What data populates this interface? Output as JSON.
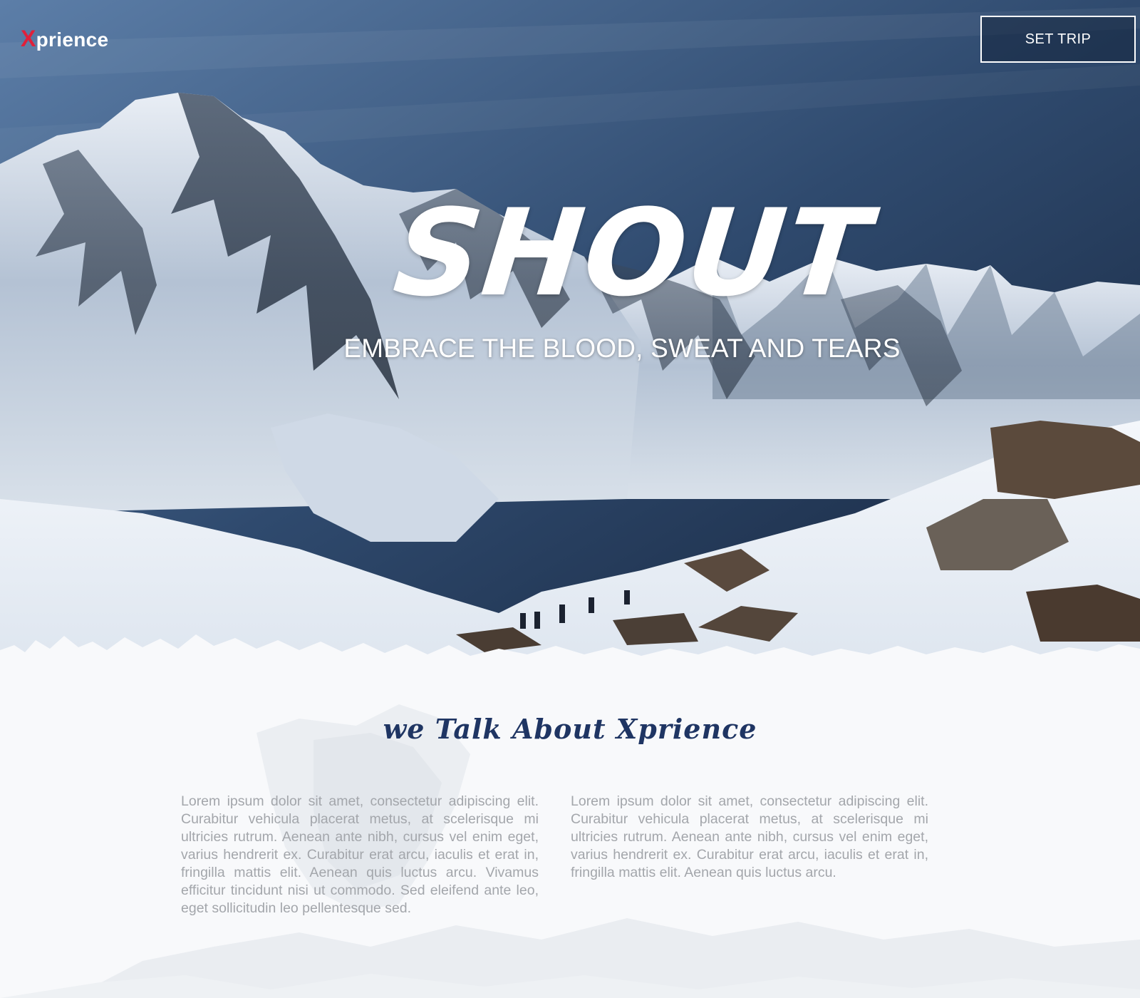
{
  "header": {
    "logo_initial": "X",
    "logo_rest": "prience",
    "set_trip_label": "SET TRIP"
  },
  "hero": {
    "title": "SHOUT",
    "tagline": "EMBRACE THE BLOOD, SWEAT AND TEARS"
  },
  "about": {
    "title": "we Talk About Xprience",
    "paragraph_left": "Lorem ipsum dolor sit amet, consectetur adipiscing elit. Curabitur vehicula placerat metus, at scelerisque mi ultricies rutrum. Aenean ante nibh, cursus vel enim eget, varius hendrerit ex. Curabitur erat arcu, iaculis et erat in, fringilla mattis elit. Aenean quis luctus arcu. Vivamus efficitur tincidunt nisi ut commodo. Sed eleifend ante leo, eget sollicitudin leo pellentesque sed.",
    "paragraph_right": "Lorem ipsum dolor sit amet, consectetur adipiscing elit. Curabitur vehicula placerat metus, at scelerisque mi ultricies rutrum. Aenean ante nibh, cursus vel enim eget, varius hendrerit ex. Curabitur erat arcu, iaculis et erat in, fringilla mattis elit. Aenean quis luctus arcu."
  },
  "colors": {
    "brand_red": "#e0203a",
    "heading_navy": "#1f3563",
    "body_gray": "#a3a6ab"
  }
}
